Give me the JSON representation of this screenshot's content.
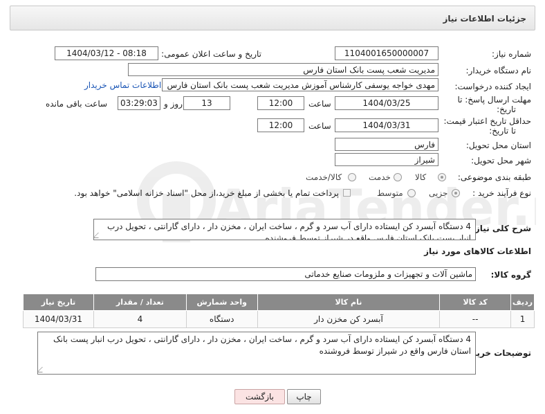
{
  "panel": {
    "title": "جزئیات اطلاعات نیاز"
  },
  "fields": {
    "need_number_label": "شماره نیاز:",
    "need_number": "1104001650000007",
    "announce_label": "تاریخ و ساعت اعلان عمومی:",
    "announce_value": "1404/03/12 - 08:18",
    "buyer_label": "نام دستگاه خریدار:",
    "buyer_value": "مدیریت شعب پست بانک استان فارس",
    "creator_label": "ایجاد کننده درخواست:",
    "creator_value": "مهدی خواجه یوسفی کارشناس آموزش مدیریت شعب پست بانک استان فارس",
    "contact_link": "اطلاعات تماس خریدار",
    "deadline_label_1": "مهلت ارسال پاسخ: تا",
    "deadline_label_2": "تاریخ:",
    "deadline_date": "1404/03/25",
    "time_label": "ساعت",
    "deadline_time": "12:00",
    "days_value": "13",
    "days_label": "روز و",
    "remaining_time": "03:29:03",
    "remaining_label": "ساعت باقی مانده",
    "price_label_1": "حداقل تاریخ اعتبار قیمت:",
    "price_label_2": "تا تاریخ:",
    "price_date": "1404/03/31",
    "price_time": "12:00",
    "province_label": "استان محل تحویل:",
    "province_value": "فارس",
    "city_label": "شهر محل تحویل:",
    "city_value": "شیراز",
    "category_label": "طبقه بندی موضوعی:",
    "category_options": [
      "کالا",
      "خدمت",
      "کالا/خدمت"
    ],
    "process_label": "نوع فرآیند خرید :",
    "process_options": [
      "جزیی",
      "متوسط"
    ],
    "payment_note": "پرداخت تمام یا بخشی از مبلغ خرید،از محل \"اسناد خزانه اسلامی\" خواهد بود."
  },
  "description": {
    "label": "شرح کلی نیاز:",
    "text": "4 دستگاه آبسرد کن ایستاده دارای آب سرد و گرم ، ساخت ایران ، مخزن دار ، دارای گارانتی ، تحویل درب انبار پست بانک استان فارس واقع در شیراز توسط فروشنده"
  },
  "goods_info": {
    "title": "اطلاعات کالاهای مورد نیاز",
    "group_label": "گروه کالا:",
    "group_value": "ماشین آلات و تجهیزات و ملزومات صنایع خدماتی"
  },
  "table": {
    "headers": [
      "ردیف",
      "کد کالا",
      "نام کالا",
      "واحد شمارش",
      "تعداد / مقدار",
      "تاریخ نیاز"
    ],
    "rows": [
      [
        "1",
        "--",
        "آبسرد کن مخزن دار",
        "دستگاه",
        "4",
        "1404/03/31"
      ]
    ]
  },
  "buyer_notes": {
    "label": "توضیحات خریدار:",
    "text": "4 دستگاه آبسرد کن ایستاده دارای آب سرد و گرم ، ساخت ایران ، مخزن دار ، دارای گارانتی ، تحویل درب انبار پست بانک استان فارس واقع در شیراز توسط فروشنده"
  },
  "buttons": {
    "print": "چاپ",
    "back": "بازگشت"
  },
  "watermark": {
    "text": "AriaTender.neT"
  },
  "colors": {
    "header_gray": "#8a8a8a",
    "link_blue": "#1a55b5",
    "back_button": "#fbe3e3"
  }
}
